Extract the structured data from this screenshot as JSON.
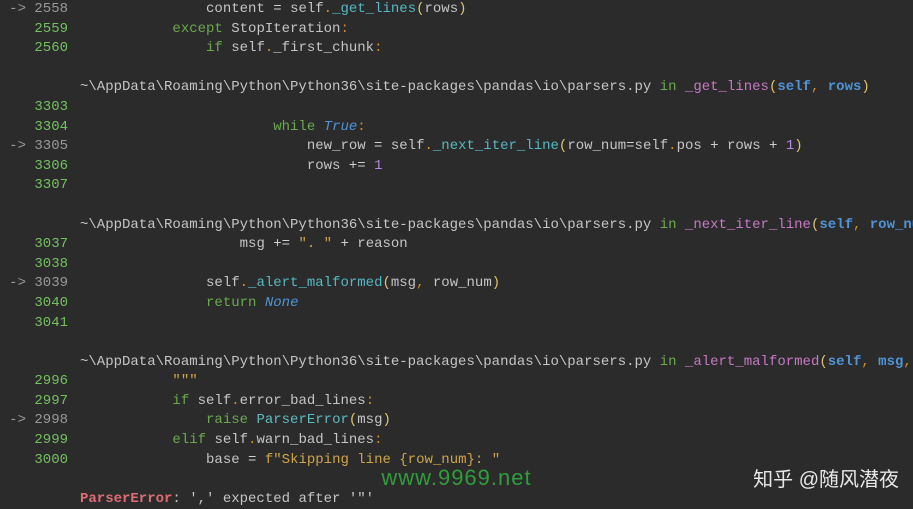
{
  "frames": [
    {
      "lines": [
        {
          "arrow": true,
          "num": "2558",
          "tokens": [
            [
              "pad",
              "               "
            ],
            [
              "name",
              "content"
            ],
            [
              "op",
              " = "
            ],
            [
              "self",
              "self"
            ],
            [
              "punct",
              "."
            ],
            [
              "fn",
              "_get_lines"
            ],
            [
              "punctY",
              "("
            ],
            [
              "name",
              "rows"
            ],
            [
              "punctY",
              ")"
            ]
          ]
        },
        {
          "arrow": false,
          "num": "2559",
          "tokens": [
            [
              "pad",
              "           "
            ],
            [
              "kw",
              "except"
            ],
            [
              "name",
              " StopIteration"
            ],
            [
              "punct",
              ":"
            ]
          ]
        },
        {
          "arrow": false,
          "num": "2560",
          "tokens": [
            [
              "pad",
              "               "
            ],
            [
              "kw",
              "if"
            ],
            [
              "name",
              " self"
            ],
            [
              "punct",
              "."
            ],
            [
              "name",
              "_first_chunk"
            ],
            [
              "punct",
              ":"
            ]
          ]
        }
      ]
    },
    {
      "header": {
        "path": "~\\AppData\\Roaming\\Python\\Python36\\site-packages\\pandas\\io\\parsers.py",
        "fn": "_get_lines",
        "params": "self, rows"
      },
      "lines": [
        {
          "arrow": false,
          "num": "3303",
          "tokens": []
        },
        {
          "arrow": false,
          "num": "3304",
          "tokens": [
            [
              "pad",
              "                       "
            ],
            [
              "kw",
              "while"
            ],
            [
              "op",
              " "
            ],
            [
              "const",
              "True"
            ],
            [
              "punct",
              ":"
            ]
          ]
        },
        {
          "arrow": true,
          "num": "3305",
          "tokens": [
            [
              "pad",
              "                           "
            ],
            [
              "name",
              "new_row"
            ],
            [
              "op",
              " = "
            ],
            [
              "self",
              "self"
            ],
            [
              "punct",
              "."
            ],
            [
              "fn",
              "_next_iter_line"
            ],
            [
              "punctY",
              "("
            ],
            [
              "name",
              "row_num"
            ],
            [
              "op",
              "="
            ],
            [
              "self",
              "self"
            ],
            [
              "punct",
              "."
            ],
            [
              "name",
              "pos"
            ],
            [
              "op",
              " + "
            ],
            [
              "name",
              "rows"
            ],
            [
              "op",
              " + "
            ],
            [
              "num",
              "1"
            ],
            [
              "punctY",
              ")"
            ]
          ]
        },
        {
          "arrow": false,
          "num": "3306",
          "tokens": [
            [
              "pad",
              "                           "
            ],
            [
              "name",
              "rows"
            ],
            [
              "op",
              " += "
            ],
            [
              "num",
              "1"
            ]
          ]
        },
        {
          "arrow": false,
          "num": "3307",
          "tokens": []
        }
      ]
    },
    {
      "header": {
        "path": "~\\AppData\\Roaming\\Python\\Python36\\site-packages\\pandas\\io\\parsers.py",
        "fn": "_next_iter_line",
        "params": "self, row_num"
      },
      "lines": [
        {
          "arrow": false,
          "num": "3037",
          "tokens": [
            [
              "pad",
              "                   "
            ],
            [
              "name",
              "msg"
            ],
            [
              "op",
              " += "
            ],
            [
              "str",
              "\". \""
            ],
            [
              "op",
              " + "
            ],
            [
              "name",
              "reason"
            ]
          ]
        },
        {
          "arrow": false,
          "num": "3038",
          "tokens": []
        },
        {
          "arrow": true,
          "num": "3039",
          "tokens": [
            [
              "pad",
              "               "
            ],
            [
              "self",
              "self"
            ],
            [
              "punct",
              "."
            ],
            [
              "fn",
              "_alert_malformed"
            ],
            [
              "punctY",
              "("
            ],
            [
              "name",
              "msg"
            ],
            [
              "punct",
              ","
            ],
            [
              "op",
              " "
            ],
            [
              "name",
              "row_num"
            ],
            [
              "punctY",
              ")"
            ]
          ]
        },
        {
          "arrow": false,
          "num": "3040",
          "tokens": [
            [
              "pad",
              "               "
            ],
            [
              "kw",
              "return"
            ],
            [
              "op",
              " "
            ],
            [
              "const",
              "None"
            ]
          ]
        },
        {
          "arrow": false,
          "num": "3041",
          "tokens": []
        }
      ]
    },
    {
      "header": {
        "path": "~\\AppData\\Roaming\\Python\\Python36\\site-packages\\pandas\\io\\parsers.py",
        "fn": "_alert_malformed",
        "params": "self, msg, row_num"
      },
      "lines": [
        {
          "arrow": false,
          "num": "2996",
          "tokens": [
            [
              "pad",
              "           "
            ],
            [
              "str",
              "\"\"\""
            ]
          ]
        },
        {
          "arrow": false,
          "num": "2997",
          "tokens": [
            [
              "pad",
              "           "
            ],
            [
              "kw",
              "if"
            ],
            [
              "op",
              " "
            ],
            [
              "self",
              "self"
            ],
            [
              "punct",
              "."
            ],
            [
              "name",
              "error_bad_lines"
            ],
            [
              "punct",
              ":"
            ]
          ]
        },
        {
          "arrow": true,
          "num": "2998",
          "tokens": [
            [
              "pad",
              "               "
            ],
            [
              "kw",
              "raise"
            ],
            [
              "op",
              " "
            ],
            [
              "exc",
              "ParserError"
            ],
            [
              "punctY",
              "("
            ],
            [
              "name",
              "msg"
            ],
            [
              "punctY",
              ")"
            ]
          ]
        },
        {
          "arrow": false,
          "num": "2999",
          "tokens": [
            [
              "pad",
              "           "
            ],
            [
              "kw",
              "elif"
            ],
            [
              "op",
              " "
            ],
            [
              "self",
              "self"
            ],
            [
              "punct",
              "."
            ],
            [
              "name",
              "warn_bad_lines"
            ],
            [
              "punct",
              ":"
            ]
          ]
        },
        {
          "arrow": false,
          "num": "3000",
          "tokens": [
            [
              "pad",
              "               "
            ],
            [
              "name",
              "base"
            ],
            [
              "op",
              " = "
            ],
            [
              "strf",
              "f\"Skipping line {row_num}: \""
            ]
          ]
        }
      ]
    }
  ],
  "error": {
    "type": "ParserError",
    "msg": ": ',' expected after '\"'"
  },
  "watermarks": {
    "center": "www.9969.net",
    "right": "知乎 @随风潜夜"
  }
}
